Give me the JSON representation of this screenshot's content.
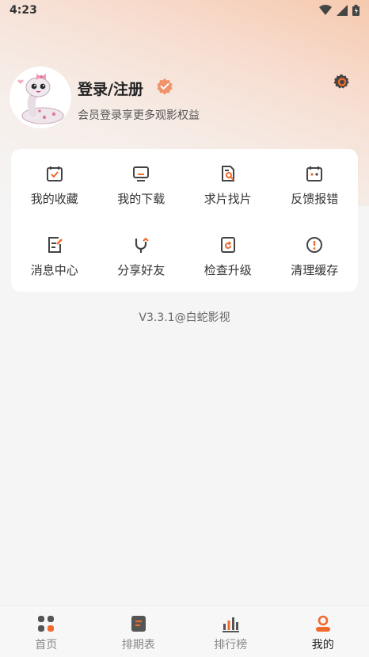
{
  "status_bar": {
    "time": "4:23"
  },
  "profile": {
    "login_label": "登录/注册",
    "subtitle": "会员登录享更多观影权益"
  },
  "menu": {
    "items": [
      {
        "label": "我的收藏",
        "icon": "calendar-check-icon"
      },
      {
        "label": "我的下载",
        "icon": "monitor-icon"
      },
      {
        "label": "求片找片",
        "icon": "document-search-icon"
      },
      {
        "label": "反馈报错",
        "icon": "calendar-dots-icon"
      },
      {
        "label": "消息中心",
        "icon": "note-edit-icon"
      },
      {
        "label": "分享好友",
        "icon": "share-icon"
      },
      {
        "label": "检查升级",
        "icon": "update-icon"
      },
      {
        "label": "清理缓存",
        "icon": "alert-circle-icon"
      }
    ]
  },
  "version": "V3.3.1@白蛇影视",
  "tabs": [
    {
      "label": "首页",
      "icon": "home-grid-icon",
      "active": false
    },
    {
      "label": "排期表",
      "icon": "schedule-icon",
      "active": false
    },
    {
      "label": "排行榜",
      "icon": "ranking-icon",
      "active": false
    },
    {
      "label": "我的",
      "icon": "profile-icon",
      "active": true
    }
  ],
  "colors": {
    "accent": "#f06a2b",
    "icon_dark": "#444444"
  }
}
